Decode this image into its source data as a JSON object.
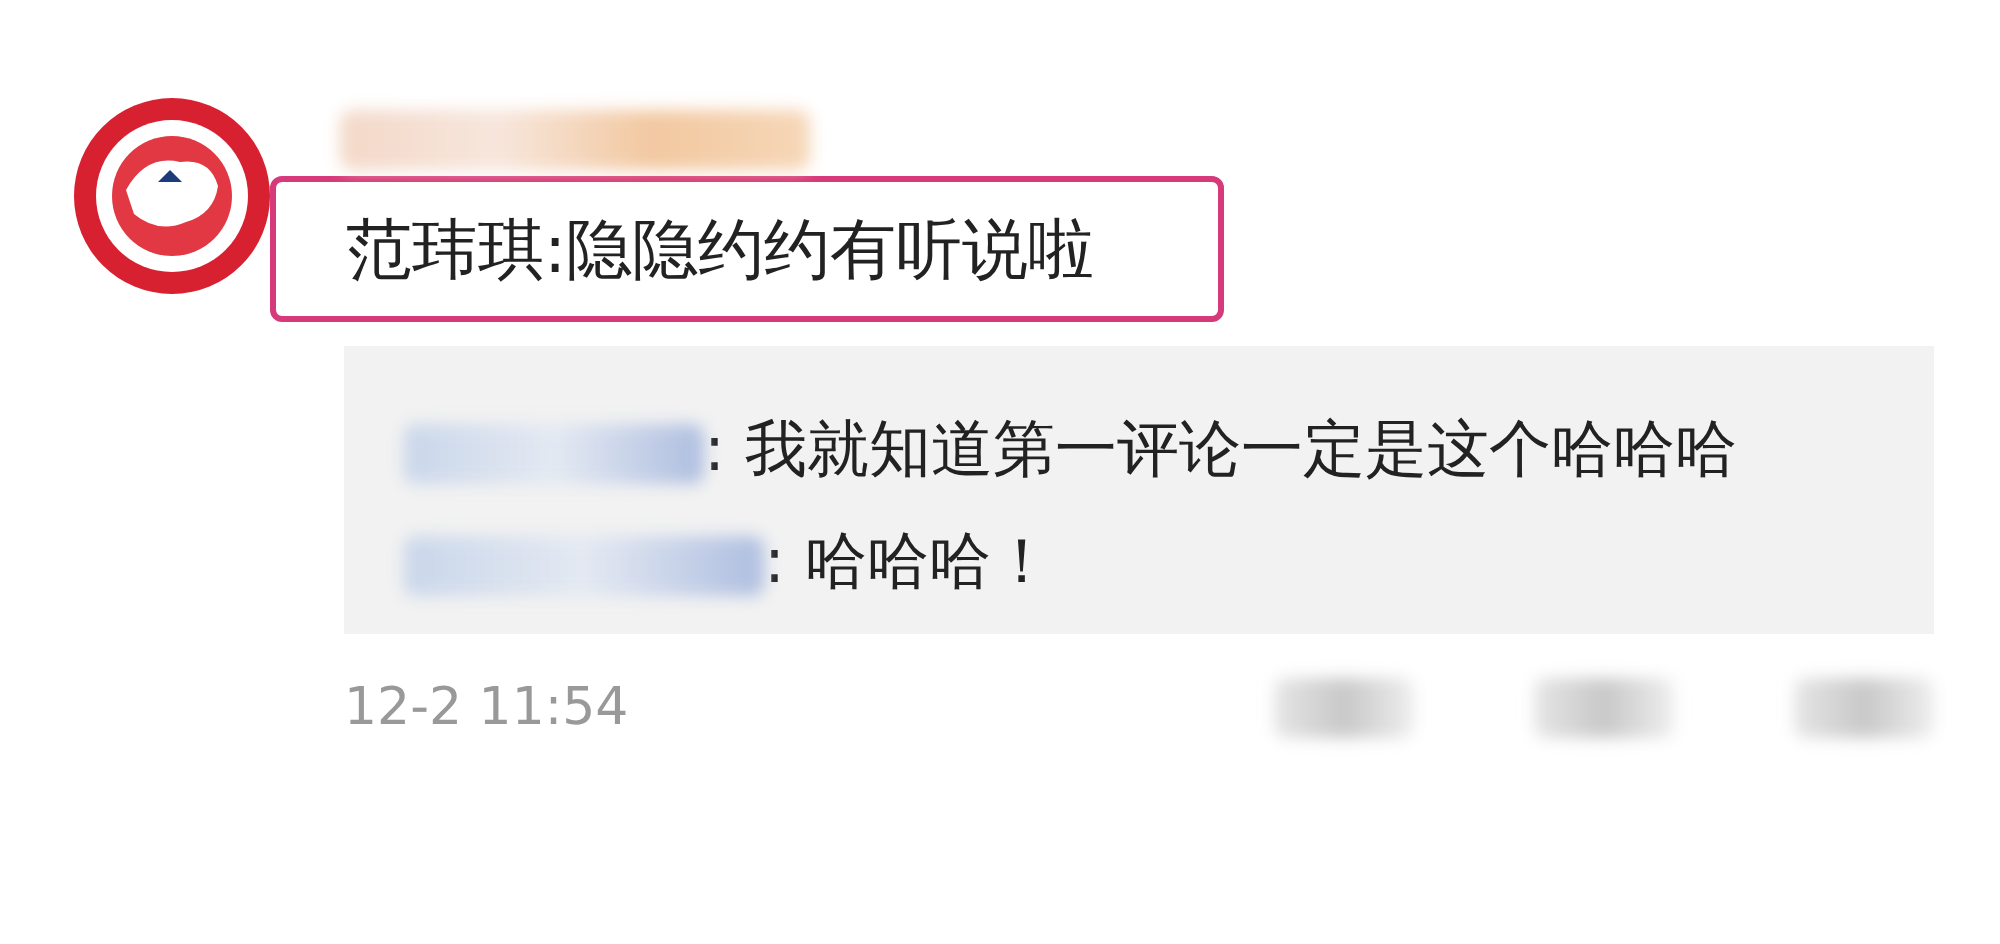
{
  "comment": {
    "text": "范玮琪:隐隐约约有听说啦",
    "highlighted": true
  },
  "replies": [
    {
      "text": ": 我就知道第一评论一定是这个哈哈哈"
    },
    {
      "text": ": 哈哈哈！"
    }
  ],
  "timestamp": "12-2 11:54"
}
